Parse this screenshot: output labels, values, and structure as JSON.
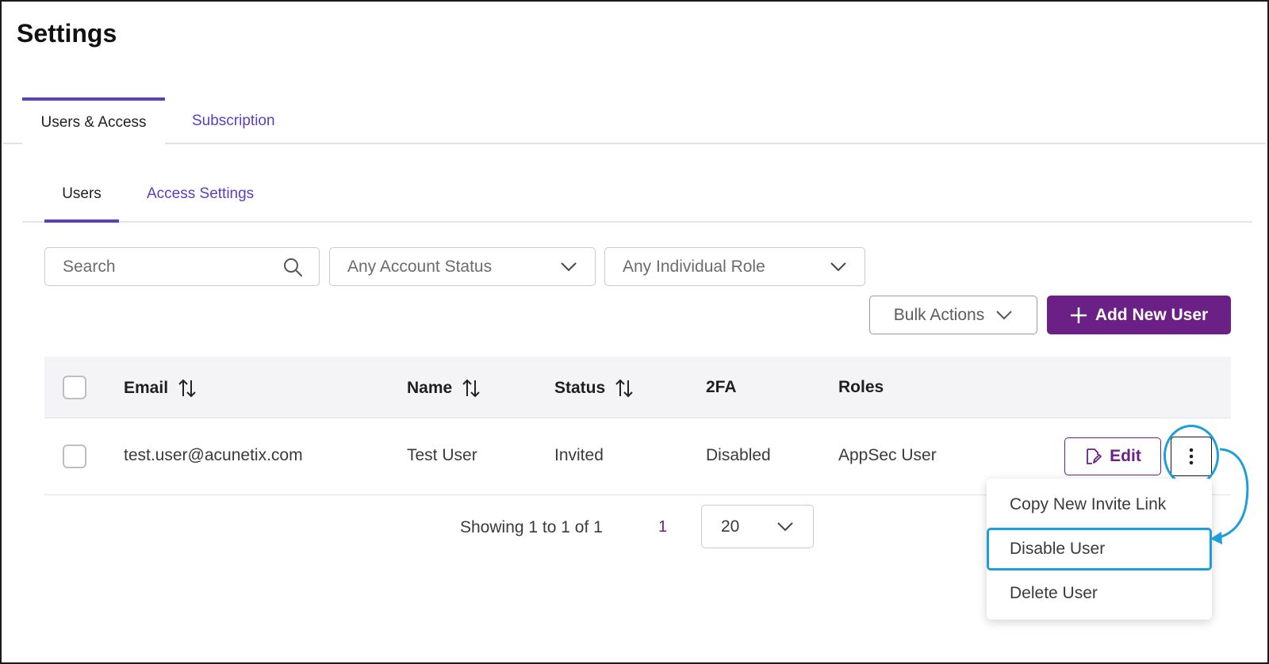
{
  "page": {
    "title": "Settings"
  },
  "top_tabs": [
    {
      "label": "Users & Access",
      "active": true
    },
    {
      "label": "Subscription",
      "active": false
    }
  ],
  "sub_tabs": [
    {
      "label": "Users",
      "active": true
    },
    {
      "label": "Access Settings",
      "active": false
    }
  ],
  "filters": {
    "search_placeholder": "Search",
    "account_status": "Any Account Status",
    "individual_role": "Any Individual Role"
  },
  "actions": {
    "bulk_label": "Bulk Actions",
    "add_label": "Add New User"
  },
  "table": {
    "columns": [
      "Email",
      "Name",
      "Status",
      "2FA",
      "Roles"
    ],
    "rows": [
      {
        "email": "test.user@acunetix.com",
        "name": "Test User",
        "status": "Invited",
        "twofa": "Disabled",
        "roles": "AppSec User"
      }
    ],
    "edit_label": "Edit"
  },
  "pagination": {
    "showing": "Showing 1 to 1 of 1",
    "current_page": "1",
    "page_size": "20"
  },
  "row_menu": {
    "items": [
      "Copy New Invite Link",
      "Disable User",
      "Delete User"
    ]
  },
  "colors": {
    "accent": "#5a3fc0",
    "primary_button": "#6b2085",
    "highlight": "#1e9fd8"
  }
}
